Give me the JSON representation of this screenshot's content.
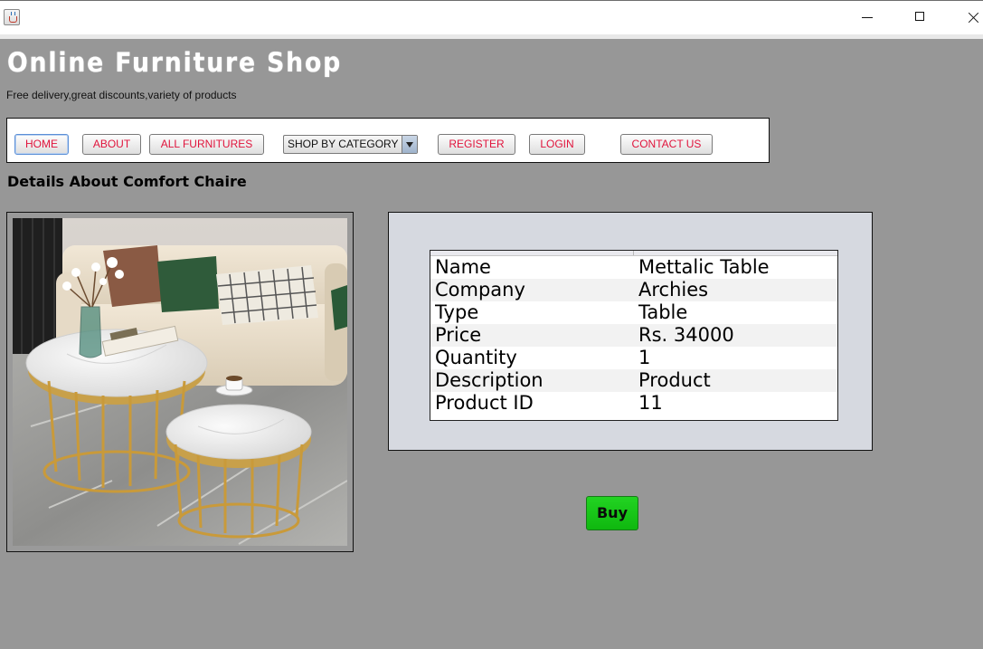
{
  "window": {
    "app_icon": "java-cup-icon",
    "controls": [
      "minimize-icon",
      "maximize-icon",
      "close-icon"
    ]
  },
  "header": {
    "title": "Online Furniture Shop",
    "tagline": "Free delivery,great discounts,variety of products"
  },
  "nav": {
    "home": "HOME",
    "about": "ABOUT",
    "all_furnitures": "ALL FURNITURES",
    "category_selected": "SHOP BY CATEGORY",
    "register": "REGISTER",
    "login": "LOGIN",
    "contact": "CONTACT US"
  },
  "details": {
    "heading": "Details About Comfort Chaire",
    "image_alt": "Nesting round marble coffee tables with gold legs in a living room"
  },
  "product_table": {
    "rows": [
      {
        "label": "Name",
        "value": "Mettalic Table"
      },
      {
        "label": "Company",
        "value": "Archies"
      },
      {
        "label": "Type",
        "value": "Table"
      },
      {
        "label": "Price",
        "value": "Rs. 34000"
      },
      {
        "label": "Quantity",
        "value": "1"
      },
      {
        "label": "Description",
        "value": "Product"
      },
      {
        "label": "Product ID",
        "value": "11"
      }
    ]
  },
  "actions": {
    "buy_label": "Buy"
  },
  "colors": {
    "background": "#979797",
    "nav_text": "#e0143c",
    "buy_button": "#1ec41e",
    "info_panel": "#d6d9e0"
  }
}
